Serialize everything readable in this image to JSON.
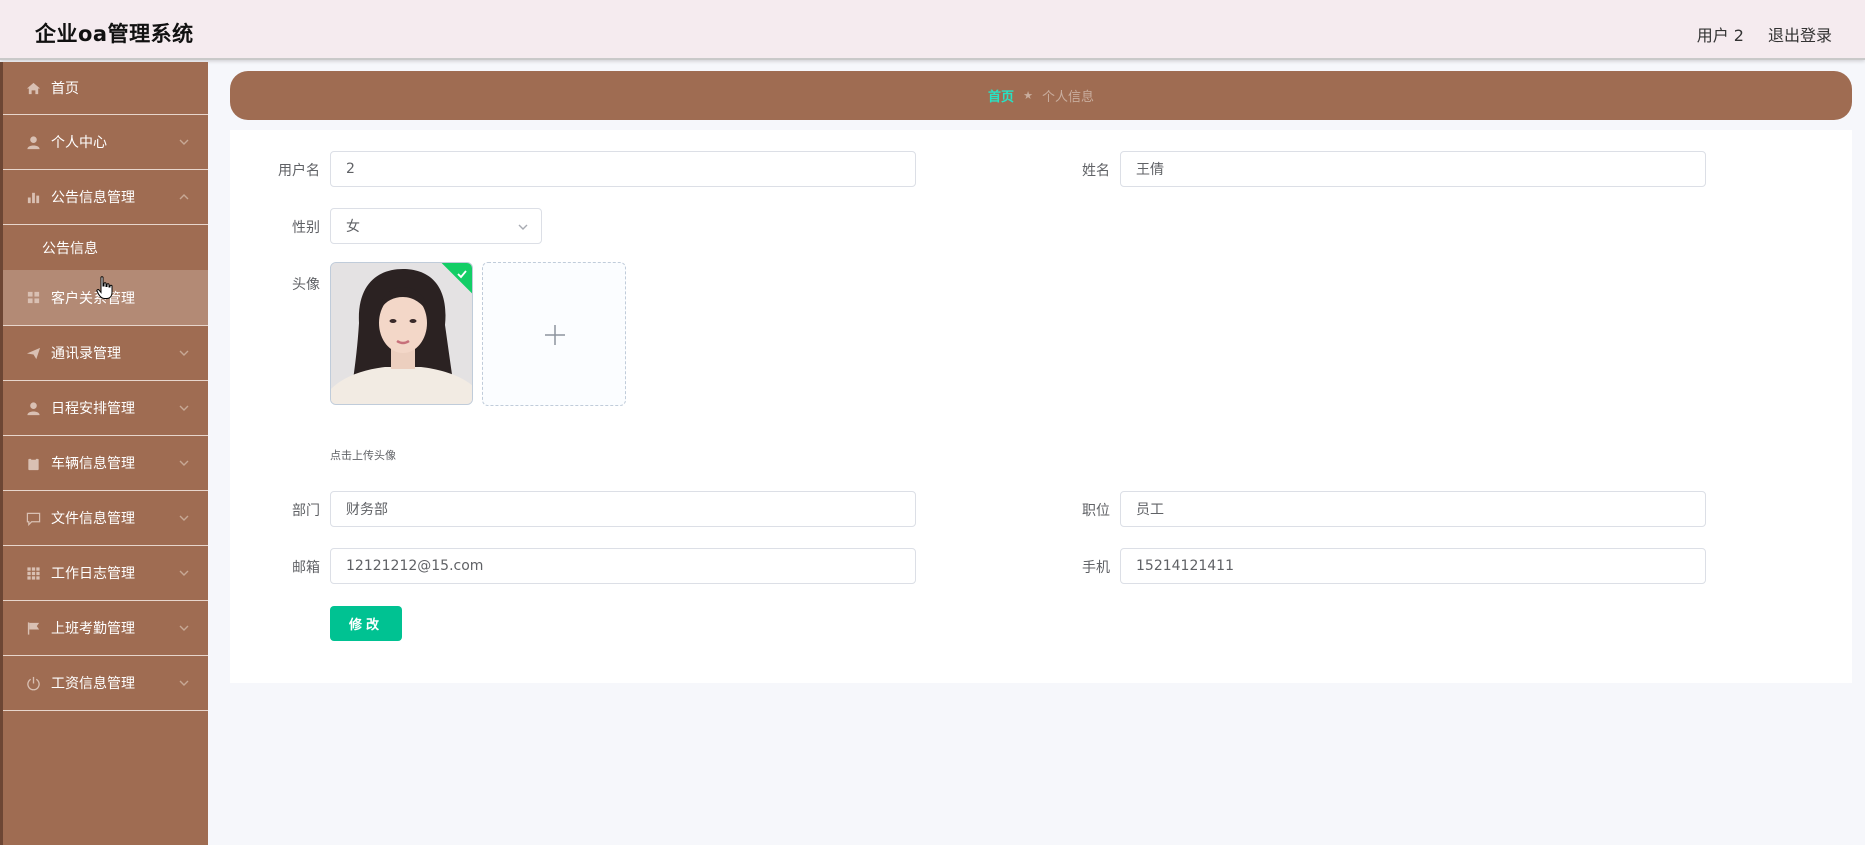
{
  "header": {
    "title": "企业oa管理系统",
    "user_label": "用户 2",
    "logout_label": "退出登录"
  },
  "sidebar": {
    "items": [
      {
        "label": "首页",
        "icon": "home-icon"
      },
      {
        "label": "个人中心",
        "icon": "user-icon"
      },
      {
        "label": "公告信息管理",
        "icon": "bar-chart-icon"
      },
      {
        "label": "公告信息",
        "icon": ""
      },
      {
        "label": "客户关系管理",
        "icon": "grid-icon"
      },
      {
        "label": "通讯录管理",
        "icon": "send-icon"
      },
      {
        "label": "日程安排管理",
        "icon": "user-icon"
      },
      {
        "label": "车辆信息管理",
        "icon": "clipboard-icon"
      },
      {
        "label": "文件信息管理",
        "icon": "chat-icon"
      },
      {
        "label": "工作日志管理",
        "icon": "grid-icon"
      },
      {
        "label": "上班考勤管理",
        "icon": "flag-icon"
      },
      {
        "label": "工资信息管理",
        "icon": "power-icon"
      }
    ]
  },
  "breadcrumb": {
    "home": "首页",
    "separator": "★",
    "current": "个人信息"
  },
  "form": {
    "username": {
      "label": "用户名",
      "value": "2"
    },
    "name": {
      "label": "姓名",
      "value": "王倩"
    },
    "gender": {
      "label": "性别",
      "value": "女"
    },
    "avatar": {
      "label": "头像",
      "tip": "点击上传头像"
    },
    "department": {
      "label": "部门",
      "value": "财务部"
    },
    "position": {
      "label": "职位",
      "value": "员工"
    },
    "email": {
      "label": "邮箱",
      "value": "12121212@15.com"
    },
    "phone": {
      "label": "手机",
      "value": "15214121411"
    },
    "submit_label": "修改"
  },
  "colors": {
    "sidebar": "#9f6c52",
    "accent": "#00c292",
    "breadcrumb_home": "#27e3c5",
    "header_bg": "#f5ebef"
  }
}
